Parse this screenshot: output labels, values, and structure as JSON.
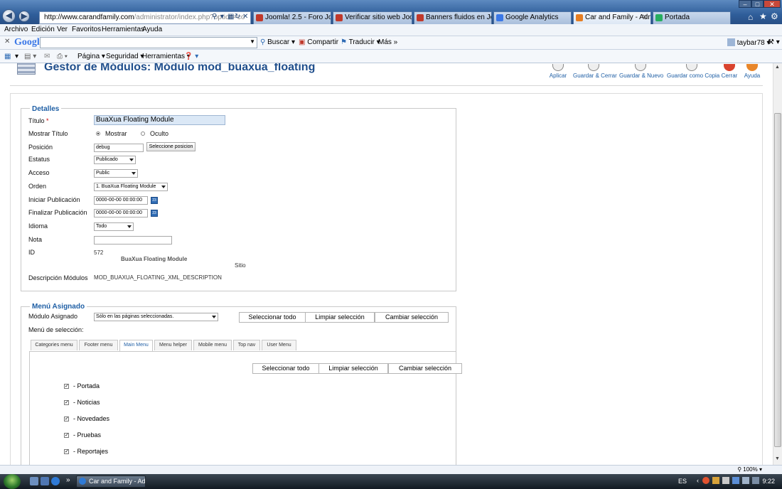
{
  "browser": {
    "url_host": "http://www.carandfamily.com",
    "url_rest": "/administrator/index.php?option=co",
    "tabs": [
      {
        "label": "Joomla! 2.5 - Foro Joomla...",
        "active": false,
        "color": "#c0392b"
      },
      {
        "label": "Verificar sitio web Joomla...",
        "active": false,
        "color": "#c0392b"
      },
      {
        "label": "Banners fluidos en Joomla...",
        "active": false,
        "color": "#c0392b"
      },
      {
        "label": "Google Analytics",
        "active": false,
        "color": "#3b78e7"
      },
      {
        "label": "Car and Family - Adm...",
        "active": true,
        "color": "#e67e22"
      },
      {
        "label": "Portada",
        "active": false,
        "color": "#27ae60"
      }
    ],
    "menu": [
      "Archivo",
      "Edición",
      "Ver",
      "Favoritos",
      "Herramientas",
      "Ayuda"
    ],
    "google": {
      "logo": "Google",
      "buscar": "Buscar",
      "compartir": "Compartir",
      "traducir": "Traducir",
      "mas": "Más",
      "user": "taybar78"
    },
    "cmd": {
      "pagina": "Página",
      "seguridad": "Seguridad",
      "herramientas": "Herramientas"
    },
    "status": {
      "zoom": "100%"
    }
  },
  "page": {
    "title": "Gestor de Módulos: Módulo mod_buaxua_floating",
    "toolbar": {
      "apply": "Aplicar",
      "save_close": "Guardar & Cerrar",
      "save_new": "Guardar & Nuevo",
      "save_copy": "Guardar como Copia",
      "close": "Cerrar",
      "help": "Ayuda"
    },
    "details": {
      "legend": "Detalles",
      "title_label": "Título",
      "title_required": "*",
      "title_value": "BuaXua Floating Module",
      "show_title_label": "Mostrar Título",
      "show_option": "Mostrar",
      "hide_option": "Oculto",
      "position_label": "Posición",
      "position_value": "debug",
      "select_position_button": "Seleccione posicion",
      "status_label": "Estatus",
      "status_value": "Publicado",
      "access_label": "Acceso",
      "access_value": "Public",
      "order_label": "Orden",
      "order_value": "1. BuaXua Floating Module",
      "start_label": "Iniciar Publicación",
      "start_value": "0000-00-00 00:00:00",
      "end_label": "Finalizar Publicación",
      "end_value": "0000-00-00 00:00:00",
      "calendar_text": "23",
      "language_label": "Idioma",
      "language_value": "Todo",
      "note_label": "Nota",
      "note_value": "",
      "id_label": "ID",
      "id_value": "572",
      "module_name": "BuaXua Floating Module",
      "site": "Sitio",
      "desc_label": "Descripción Módulos",
      "desc_value": "MOD_BUAXUA_FLOATING_XML_DESCRIPTION"
    },
    "menu_assignment": {
      "legend": "Menú Asignado",
      "module_assigned_label": "Módulo Asignado",
      "module_assigned_value": "Sólo en las páginas seleccionadas.",
      "select_all": "Seleccionar todo",
      "clear_selection": "Limpiar selección",
      "toggle_selection": "Cambiar selección",
      "menu_selection_label": "Menú de selección:",
      "tabs": [
        "Categories menu",
        "Footer menu",
        "Main Menu",
        "Menu helper",
        "Mobile menu",
        "Top nav",
        "User Menu"
      ],
      "active_tab": "Main Menu",
      "items": [
        "- Portada",
        "- Noticias",
        "- Novedades",
        "- Pruebas",
        "- Reportajes"
      ]
    }
  },
  "taskbar": {
    "item": "Car and Family - Ad...",
    "lang": "ES",
    "time": "9:22"
  }
}
